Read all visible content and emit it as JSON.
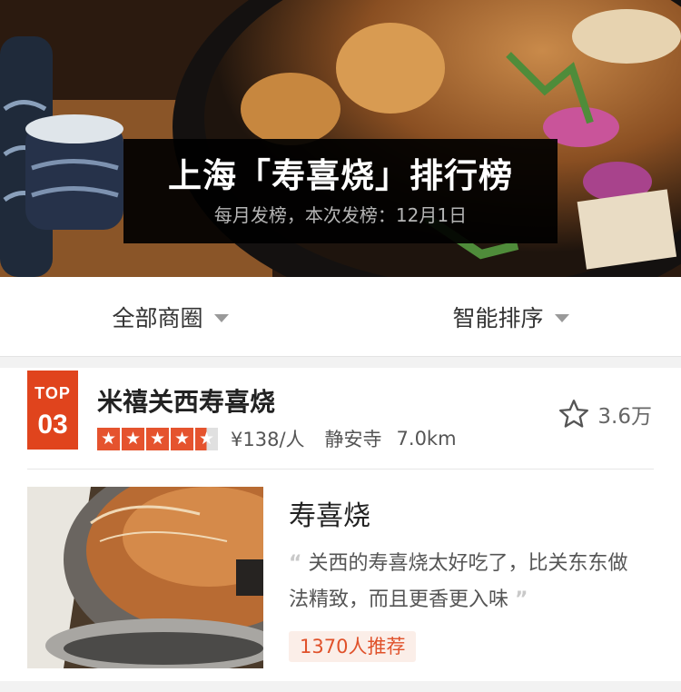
{
  "banner": {
    "title": "上海「寿喜烧」排行榜",
    "subtitle": "每月发榜，本次发榜：12月1日"
  },
  "filters": {
    "area_label": "全部商圈",
    "sort_label": "智能排序"
  },
  "shop": {
    "rank_top": "TOP",
    "rank_num": "03",
    "name": "米禧关西寿喜烧",
    "rating_stars": 4.5,
    "price": "¥138/人",
    "area": "静安寺",
    "distance": "7.0km",
    "favorites": "3.6万",
    "dish": {
      "title": "寿喜烧",
      "quote_open": "“",
      "quote": "关西的寿喜烧太好吃了，比关东东做法精致，而且更香更入味",
      "quote_close": "”",
      "recommend": "1370人推荐"
    }
  },
  "colors": {
    "accent": "#e0441d",
    "star": "#e5532e",
    "recommend_bg": "#fbeee8"
  }
}
